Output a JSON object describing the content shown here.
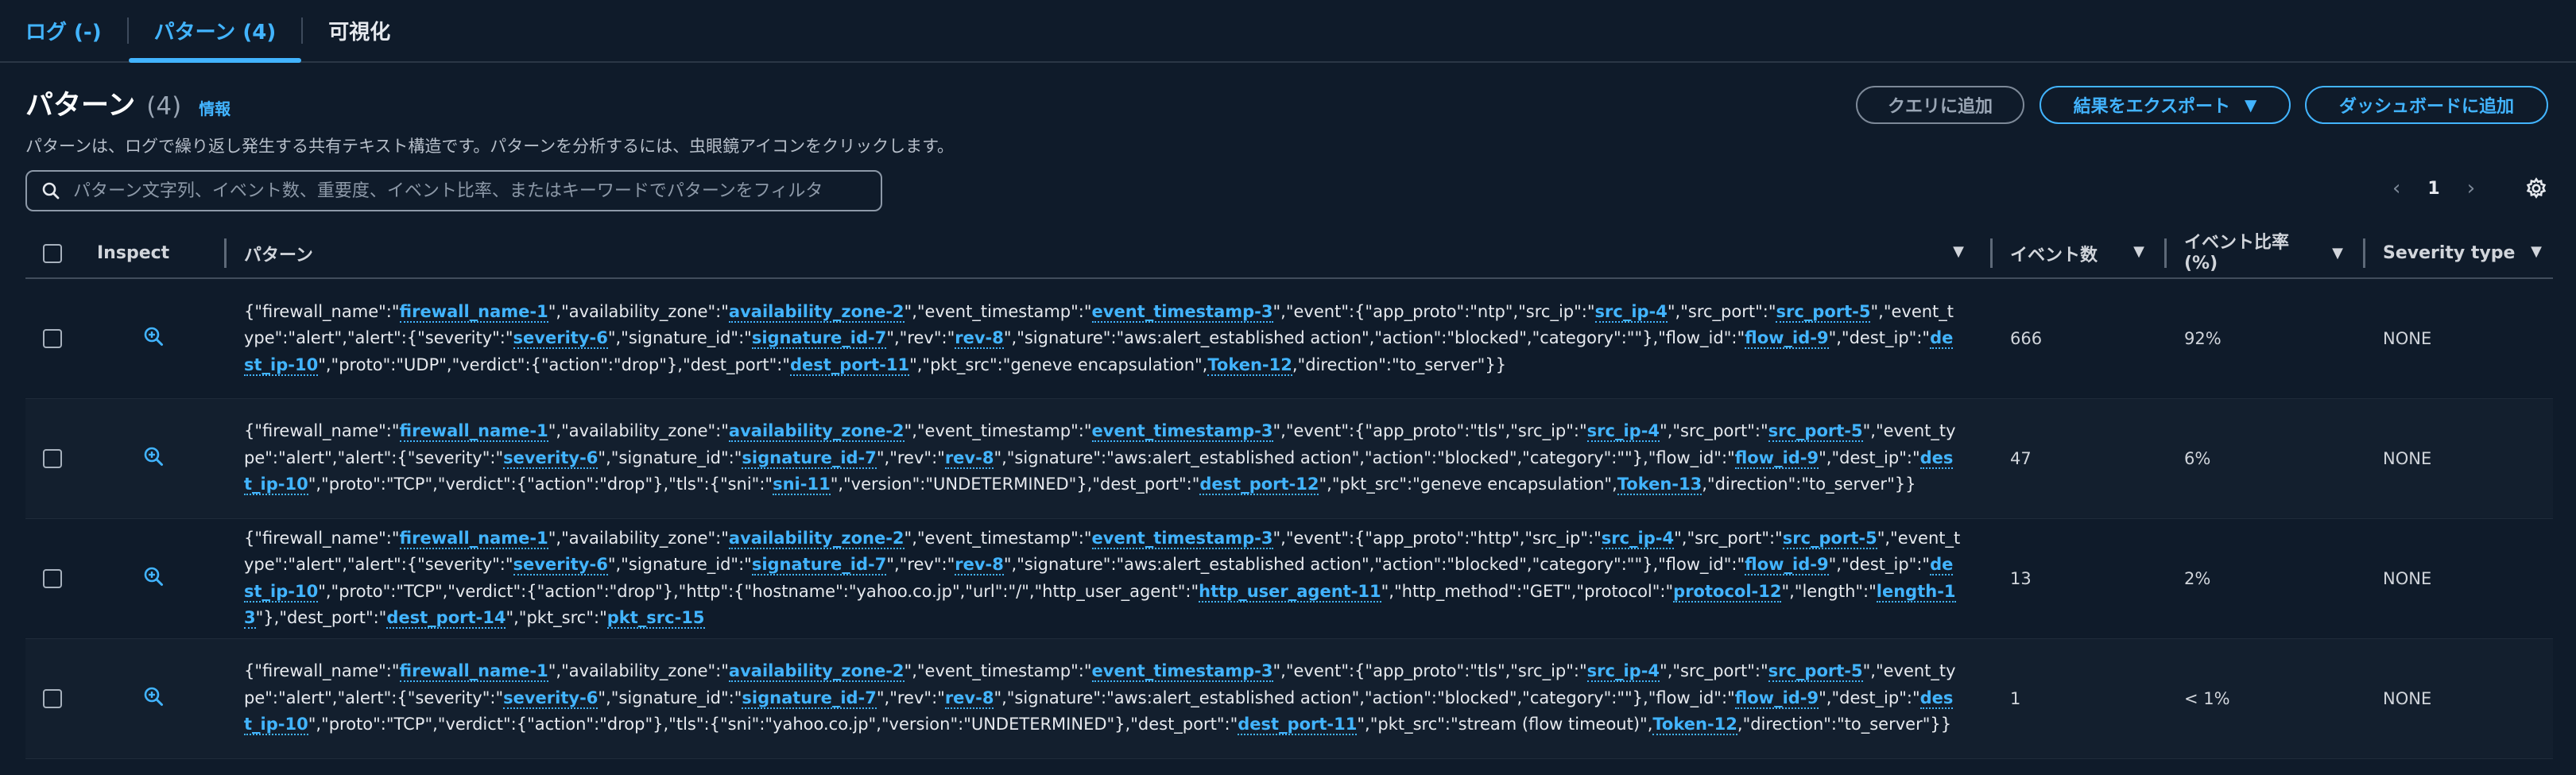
{
  "tabs": [
    {
      "label": "ログ (-)"
    },
    {
      "label": "パターン (4)"
    },
    {
      "label": "可視化"
    }
  ],
  "header": {
    "title": "パターン",
    "count": "(4)",
    "info": "情報",
    "description": "パターンは、ログで繰り返し発生する共有テキスト構造です。パターンを分析するには、虫眼鏡アイコンをクリックします。",
    "buttons": {
      "add_query": "クエリに追加",
      "export": "結果をエクスポート",
      "add_dashboard": "ダッシュボードに追加"
    }
  },
  "search": {
    "placeholder": "パターン文字列、イベント数、重要度、イベント比率、またはキーワードでパターンをフィルタ"
  },
  "pager": {
    "page": "1"
  },
  "table": {
    "columns": {
      "inspect": "Inspect",
      "pattern": "パターン",
      "events": "イベント数",
      "ratio": "イベント比率 (%)",
      "severity": "Severity type"
    },
    "rows": [
      {
        "segments": [
          {
            "t": "{\"firewall_name\":\""
          },
          {
            "k": "firewall_name-1"
          },
          {
            "t": "\",\"availability_zone\":\""
          },
          {
            "k": "availability_zone-2"
          },
          {
            "t": "\",\"event_timestamp\":\""
          },
          {
            "k": "event_timestamp-3"
          },
          {
            "t": "\",\"event\":{\"app_proto\":\"ntp\",\"src_ip\":\""
          },
          {
            "k": "src_ip-4"
          },
          {
            "t": "\",\"src_port\":\""
          },
          {
            "k": "src_port-5"
          },
          {
            "t": "\",\"event_type\":\"alert\",\"alert\":{\"severity\":\""
          },
          {
            "k": "severity-6"
          },
          {
            "t": "\",\"signature_id\":\""
          },
          {
            "k": "signature_id-7"
          },
          {
            "t": "\",\"rev\":\""
          },
          {
            "k": "rev-8"
          },
          {
            "t": "\",\"signature\":\"aws:alert_established action\",\"action\":\"blocked\",\"category\":\"\"},\"flow_id\":\""
          },
          {
            "k": "flow_id-9"
          },
          {
            "t": "\",\"dest_ip\":\""
          },
          {
            "k": "dest_ip-10"
          },
          {
            "t": "\",\"proto\":\"UDP\",\"verdict\":{\"action\":\"drop\"},\"dest_port\":\""
          },
          {
            "k": "dest_port-11"
          },
          {
            "t": "\",\"pkt_src\":\"geneve encapsulation\","
          },
          {
            "k": "Token-12"
          },
          {
            "t": ",\"direction\":\"to_server\"}}"
          }
        ],
        "events": "666",
        "ratio": "92%",
        "severity": "NONE"
      },
      {
        "segments": [
          {
            "t": "{\"firewall_name\":\""
          },
          {
            "k": "firewall_name-1"
          },
          {
            "t": "\",\"availability_zone\":\""
          },
          {
            "k": "availability_zone-2"
          },
          {
            "t": "\",\"event_timestamp\":\""
          },
          {
            "k": "event_timestamp-3"
          },
          {
            "t": "\",\"event\":{\"app_proto\":\"tls\",\"src_ip\":\""
          },
          {
            "k": "src_ip-4"
          },
          {
            "t": "\",\"src_port\":\""
          },
          {
            "k": "src_port-5"
          },
          {
            "t": "\",\"event_type\":\"alert\",\"alert\":{\"severity\":\""
          },
          {
            "k": "severity-6"
          },
          {
            "t": "\",\"signature_id\":\""
          },
          {
            "k": "signature_id-7"
          },
          {
            "t": "\",\"rev\":\""
          },
          {
            "k": "rev-8"
          },
          {
            "t": "\",\"signature\":\"aws:alert_established action\",\"action\":\"blocked\",\"category\":\"\"},\"flow_id\":\""
          },
          {
            "k": "flow_id-9"
          },
          {
            "t": "\",\"dest_ip\":\""
          },
          {
            "k": "dest_ip-10"
          },
          {
            "t": "\",\"proto\":\"TCP\",\"verdict\":{\"action\":\"drop\"},\"tls\":{\"sni\":\""
          },
          {
            "k": "sni-11"
          },
          {
            "t": "\",\"version\":\"UNDETERMINED\"},\"dest_port\":\""
          },
          {
            "k": "dest_port-12"
          },
          {
            "t": "\",\"pkt_src\":\"geneve encapsulation\","
          },
          {
            "k": "Token-13"
          },
          {
            "t": ",\"direction\":\"to_server\"}}"
          }
        ],
        "events": "47",
        "ratio": "6%",
        "severity": "NONE"
      },
      {
        "segments": [
          {
            "t": "{\"firewall_name\":\""
          },
          {
            "k": "firewall_name-1"
          },
          {
            "t": "\",\"availability_zone\":\""
          },
          {
            "k": "availability_zone-2"
          },
          {
            "t": "\",\"event_timestamp\":\""
          },
          {
            "k": "event_timestamp-3"
          },
          {
            "t": "\",\"event\":{\"app_proto\":\"http\",\"src_ip\":\""
          },
          {
            "k": "src_ip-4"
          },
          {
            "t": "\",\"src_port\":\""
          },
          {
            "k": "src_port-5"
          },
          {
            "t": "\",\"event_type\":\"alert\",\"alert\":{\"severity\":\""
          },
          {
            "k": "severity-6"
          },
          {
            "t": "\",\"signature_id\":\""
          },
          {
            "k": "signature_id-7"
          },
          {
            "t": "\",\"rev\":\""
          },
          {
            "k": "rev-8"
          },
          {
            "t": "\",\"signature\":\"aws:alert_established action\",\"action\":\"blocked\",\"category\":\"\"},\"flow_id\":\""
          },
          {
            "k": "flow_id-9"
          },
          {
            "t": "\",\"dest_ip\":\""
          },
          {
            "k": "dest_ip-10"
          },
          {
            "t": "\",\"proto\":\"TCP\",\"verdict\":{\"action\":\"drop\"},\"http\":{\"hostname\":\"yahoo.co.jp\",\"url\":\"/\",\"http_user_agent\":\""
          },
          {
            "k": "http_user_agent-11"
          },
          {
            "t": "\",\"http_method\":\"GET\",\"protocol\":\""
          },
          {
            "k": "protocol-12"
          },
          {
            "t": "\",\"length\":\""
          },
          {
            "k": "length-13"
          },
          {
            "t": "\"},\"dest_port\":\""
          },
          {
            "k": "dest_port-14"
          },
          {
            "t": "\",\"pkt_src\":\""
          },
          {
            "k": "pkt_src-15"
          }
        ],
        "events": "13",
        "ratio": "2%",
        "severity": "NONE"
      },
      {
        "segments": [
          {
            "t": "{\"firewall_name\":\""
          },
          {
            "k": "firewall_name-1"
          },
          {
            "t": "\",\"availability_zone\":\""
          },
          {
            "k": "availability_zone-2"
          },
          {
            "t": "\",\"event_timestamp\":\""
          },
          {
            "k": "event_timestamp-3"
          },
          {
            "t": "\",\"event\":{\"app_proto\":\"tls\",\"src_ip\":\""
          },
          {
            "k": "src_ip-4"
          },
          {
            "t": "\",\"src_port\":\""
          },
          {
            "k": "src_port-5"
          },
          {
            "t": "\",\"event_type\":\"alert\",\"alert\":{\"severity\":\""
          },
          {
            "k": "severity-6"
          },
          {
            "t": "\",\"signature_id\":\""
          },
          {
            "k": "signature_id-7"
          },
          {
            "t": "\",\"rev\":\""
          },
          {
            "k": "rev-8"
          },
          {
            "t": "\",\"signature\":\"aws:alert_established action\",\"action\":\"blocked\",\"category\":\"\"},\"flow_id\":\""
          },
          {
            "k": "flow_id-9"
          },
          {
            "t": "\",\"dest_ip\":\""
          },
          {
            "k": "dest_ip-10"
          },
          {
            "t": "\",\"proto\":\"TCP\",\"verdict\":{\"action\":\"drop\"},\"tls\":{\"sni\":\"yahoo.co.jp\",\"version\":\"UNDETERMINED\"},\"dest_port\":\""
          },
          {
            "k": "dest_port-11"
          },
          {
            "t": "\",\"pkt_src\":\"stream (flow timeout)\","
          },
          {
            "k": "Token-12"
          },
          {
            "t": ",\"direction\":\"to_server\"}}"
          }
        ],
        "events": "1",
        "ratio": "< 1%",
        "severity": "NONE"
      }
    ]
  },
  "colors": {
    "accent": "#42b4ff",
    "background": "#0f1b2a"
  }
}
